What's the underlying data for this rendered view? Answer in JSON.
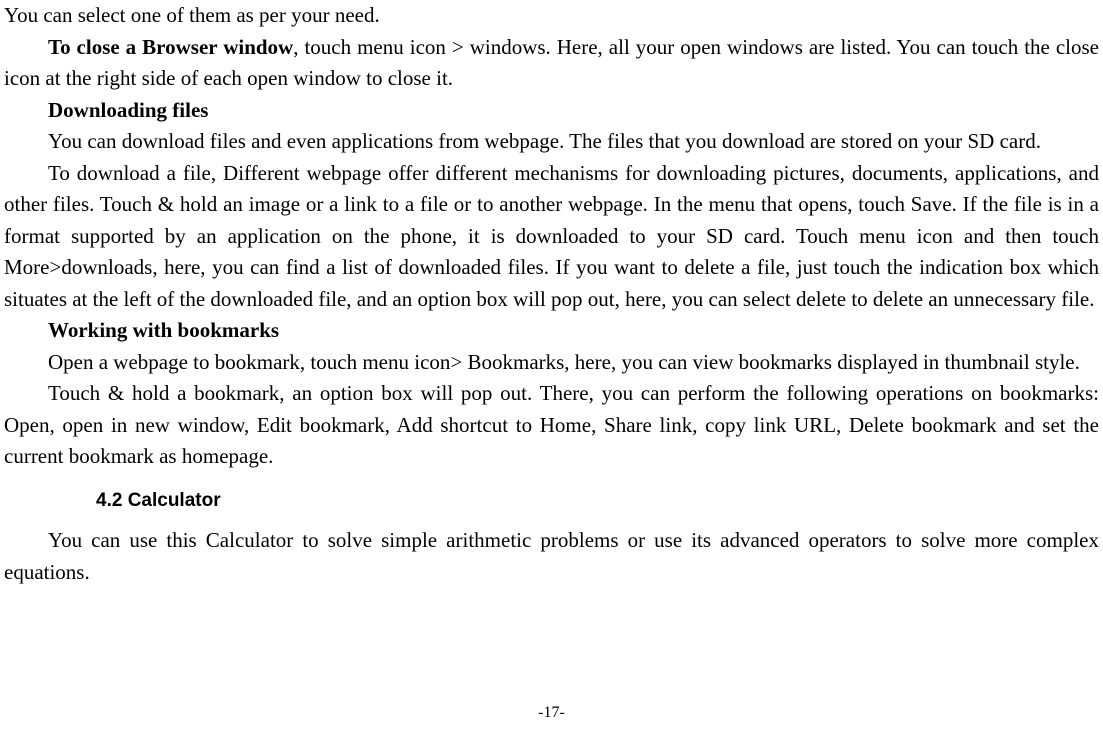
{
  "paragraphs": {
    "p1": "You can select one of them as per your need.",
    "p2_bold": "To close a Browser window",
    "p2_rest": ", touch menu icon > windows. Here, all your open windows are listed. You can touch the close icon at the right side of each open window to close it.",
    "h1": "Downloading files",
    "p3": "You can download files and even applications from webpage. The files that you download are stored on your SD card.",
    "p4": "To download a file, Different webpage offer different mechanisms for downloading pictures, documents, applications, and other files. Touch & hold an image or a link to a file or to another webpage. In the menu that opens, touch Save. If the file is in a format supported by an application on the phone, it is downloaded to your SD card. Touch menu icon and then touch More>downloads, here, you can find a list of downloaded files. If you want to delete a file, just touch the indication box which situates at the left of the downloaded file, and an option box will pop out, here, you can select delete to delete an unnecessary file.",
    "h2": "Working with bookmarks",
    "p5": "Open a webpage to bookmark, touch menu icon> Bookmarks, here, you can view bookmarks displayed in thumbnail style.",
    "p6": "Touch & hold a bookmark, an option box will pop out. There, you can perform the following operations on bookmarks: Open, open in new window, Edit bookmark, Add shortcut to Home, Share link, copy link URL, Delete bookmark and set the current bookmark as homepage.",
    "section": "4.2    Calculator",
    "p7": "You can use this Calculator to solve simple arithmetic problems or use its advanced operators to solve more complex equations."
  },
  "pageNumber": "-17-"
}
